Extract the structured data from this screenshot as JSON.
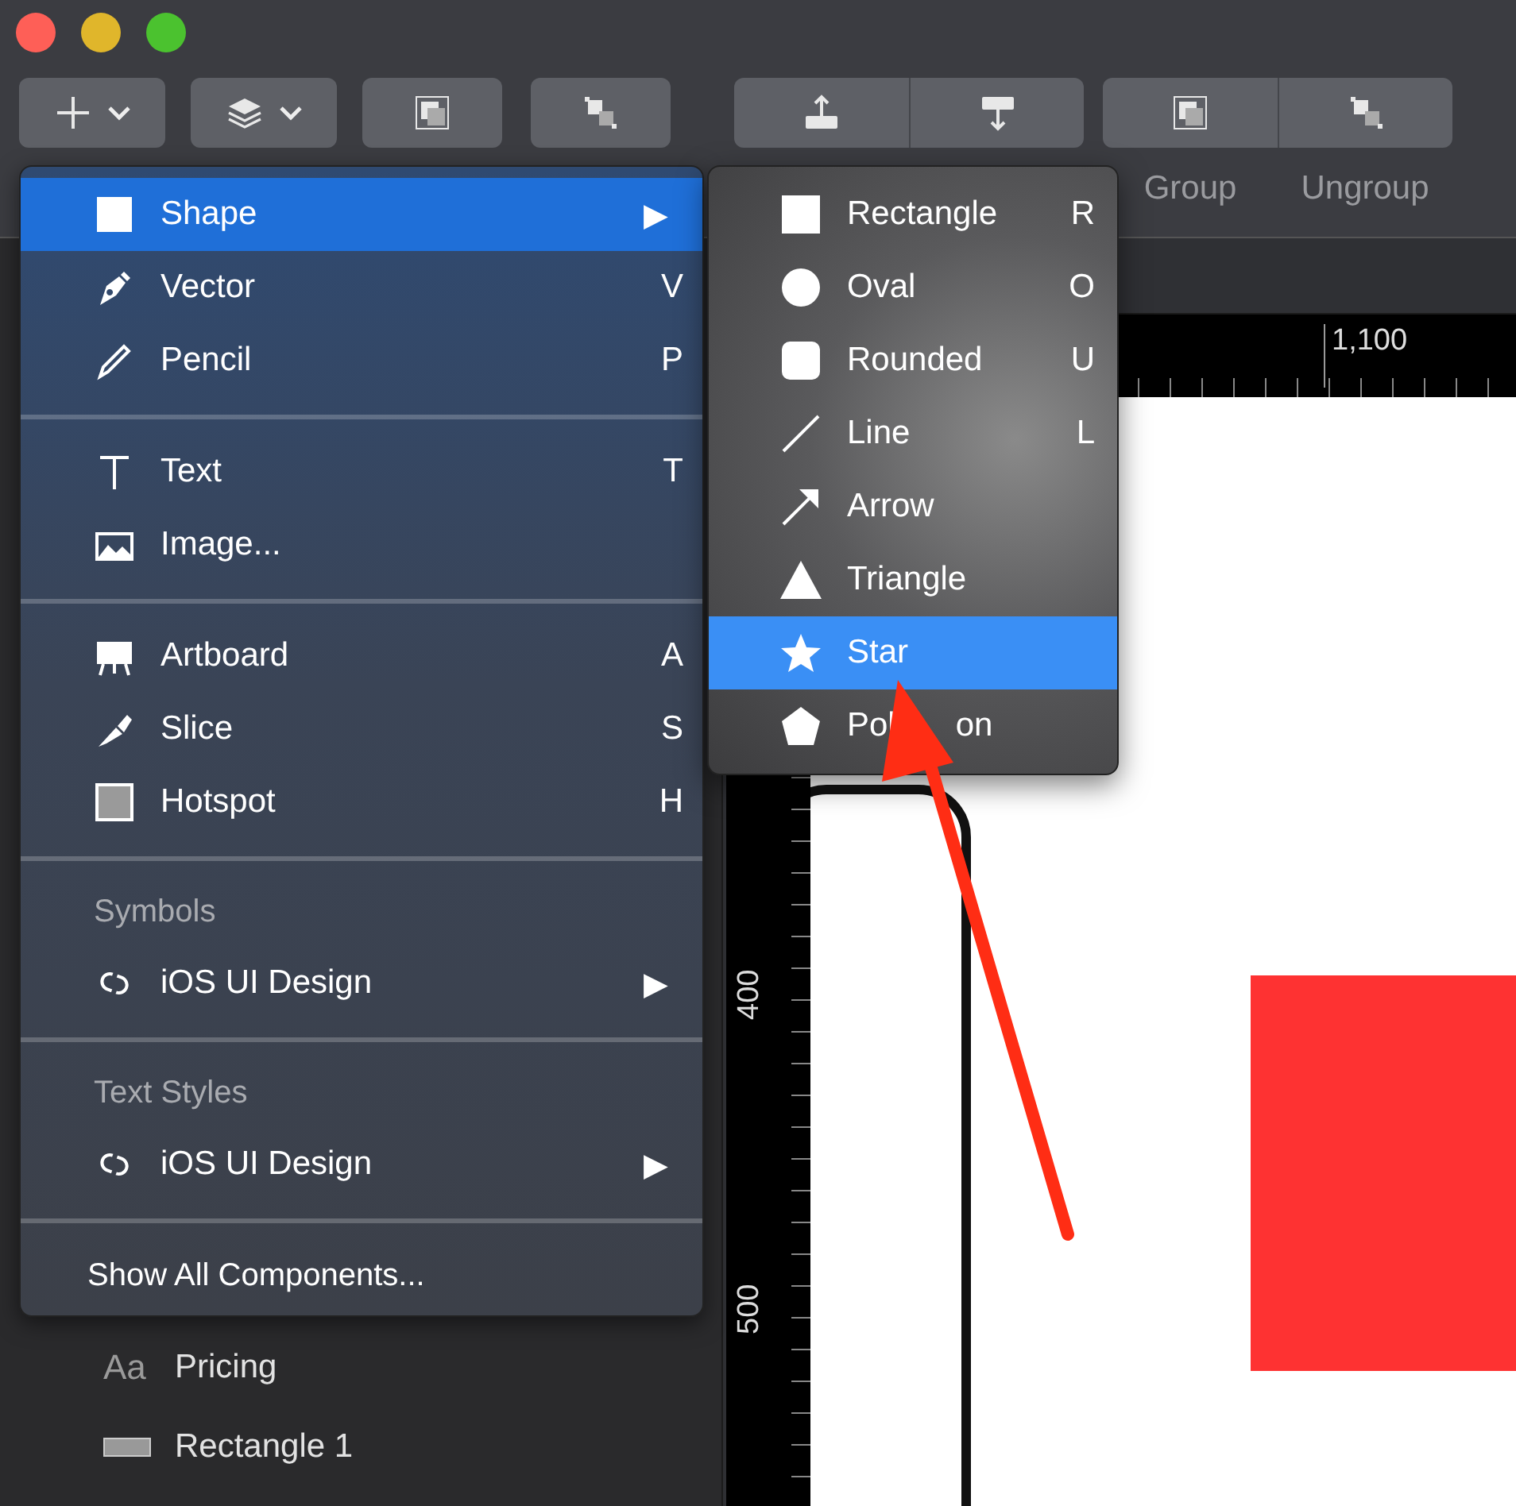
{
  "toolbar": {
    "buttons": [
      {
        "kind": "insert",
        "dropdown": true
      },
      {
        "kind": "layers",
        "dropdown": true
      },
      {
        "kind": "frame",
        "dropdown": false
      },
      {
        "kind": "scatter",
        "dropdown": false
      }
    ],
    "segmented": [
      {
        "buttons": [
          {
            "kind": "forward"
          },
          {
            "kind": "backward"
          }
        ]
      },
      {
        "buttons": [
          {
            "kind": "group",
            "label": "Group"
          },
          {
            "kind": "ungroup",
            "label": "Ungroup"
          }
        ]
      }
    ]
  },
  "insert_menu": {
    "items": [
      {
        "kind": "item",
        "label": "Shape",
        "submenu_arrow": "▶",
        "selected": true
      },
      {
        "kind": "item",
        "label": "Vector",
        "shortcut": "V",
        "selected": false
      },
      {
        "kind": "item",
        "label": "Pencil",
        "shortcut": "P",
        "selected": false
      },
      {
        "kind": "separator"
      },
      {
        "kind": "item",
        "label": "Text",
        "shortcut": "T",
        "selected": false
      },
      {
        "kind": "item",
        "label": "Image...",
        "selected": false
      },
      {
        "kind": "separator"
      },
      {
        "kind": "item",
        "label": "Artboard",
        "shortcut": "A",
        "selected": false
      },
      {
        "kind": "item",
        "label": "Slice",
        "shortcut": "S",
        "selected": false
      },
      {
        "kind": "item",
        "label": "Hotspot",
        "shortcut": "H",
        "selected": false
      },
      {
        "kind": "separator"
      },
      {
        "kind": "header",
        "label": "Symbols"
      },
      {
        "kind": "item",
        "label": "iOS UI Design",
        "submenu_arrow": "▶",
        "selected": false
      },
      {
        "kind": "separator"
      },
      {
        "kind": "header",
        "label": "Text Styles"
      },
      {
        "kind": "item",
        "label": "iOS UI Design",
        "submenu_arrow": "▶",
        "selected": false
      },
      {
        "kind": "separator"
      },
      {
        "kind": "plain",
        "label": "Show All Components..."
      }
    ]
  },
  "shape_submenu": {
    "items": [
      {
        "label": "Rectangle",
        "shortcut": "R",
        "selected": false
      },
      {
        "label": "Oval",
        "shortcut": "O",
        "selected": false
      },
      {
        "label": "Rounded",
        "shortcut": "U",
        "selected": false
      },
      {
        "label": "Line",
        "shortcut": "L",
        "selected": false
      },
      {
        "label": "Arrow",
        "selected": false
      },
      {
        "label": "Triangle",
        "selected": false
      },
      {
        "label": "Star",
        "selected": true
      },
      {
        "label": "Pol",
        "label_tail": "on",
        "selected": false
      }
    ]
  },
  "layers": [
    {
      "kind": "text",
      "glyph": "Aa",
      "label": "Pricing"
    },
    {
      "kind": "shape",
      "label": "Rectangle 1"
    }
  ],
  "rulers": {
    "horizontal": [
      "1,100"
    ],
    "vertical": [
      "400",
      "500"
    ]
  }
}
